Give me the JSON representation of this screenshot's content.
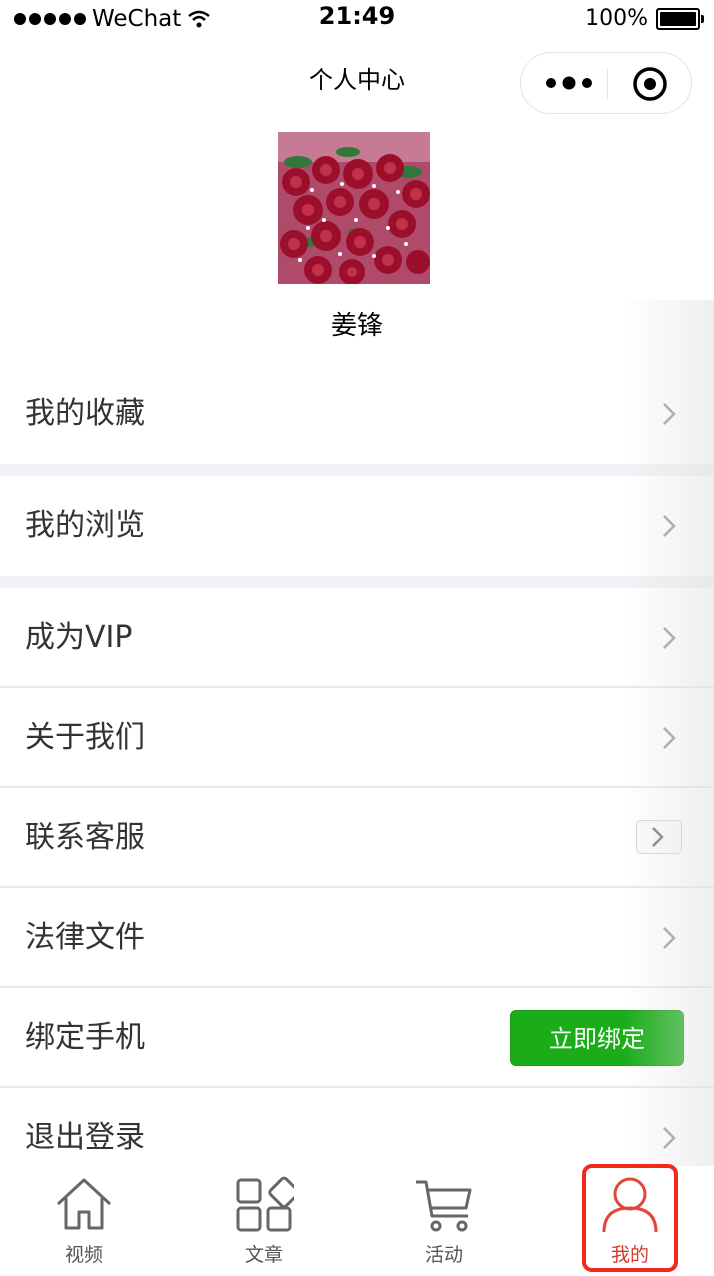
{
  "status_bar": {
    "carrier": "WeChat",
    "time": "21:49",
    "battery": "100%"
  },
  "nav": {
    "title": "个人中心"
  },
  "profile": {
    "username": "姜锋"
  },
  "menu": {
    "favorites": "我的收藏",
    "history": "我的浏览",
    "vip": "成为VIP",
    "about": "关于我们",
    "contact": "联系客服",
    "legal": "法律文件",
    "bind_phone": "绑定手机",
    "bind_button": "立即绑定",
    "logout": "退出登录"
  },
  "tabbar": {
    "tabs": [
      {
        "label": "视频",
        "icon": "home-icon"
      },
      {
        "label": "文章",
        "icon": "grid-icon"
      },
      {
        "label": "活动",
        "icon": "cart-icon"
      },
      {
        "label": "我的",
        "icon": "user-icon"
      }
    ],
    "active_index": 3
  },
  "colors": {
    "accent_green": "#1aad19",
    "active_tab": "#d33a2c",
    "highlight_box": "#f2281c"
  }
}
